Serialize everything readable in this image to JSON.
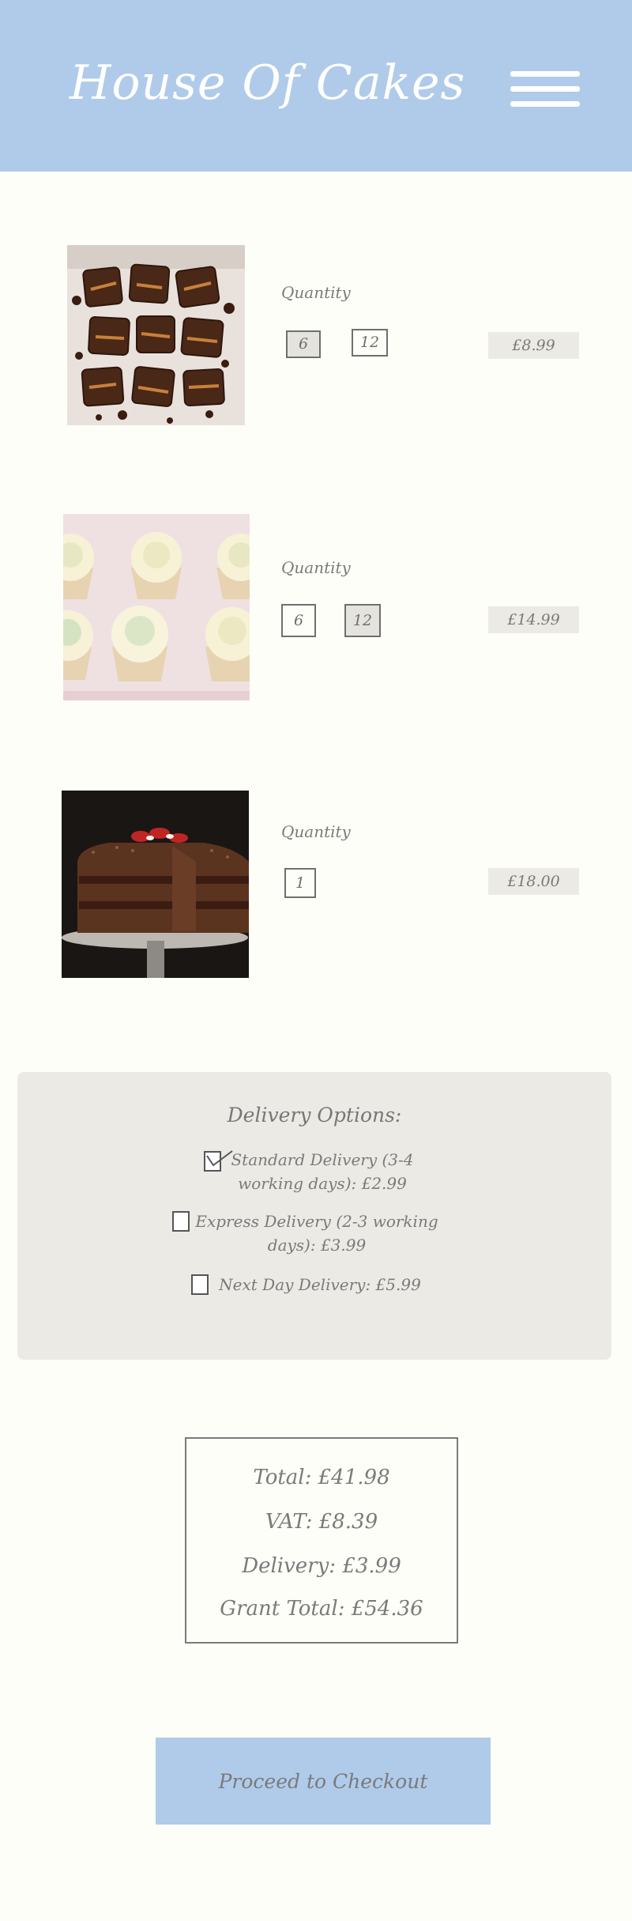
{
  "header": {
    "brand": "House Of Cakes",
    "menu_icon": "hamburger-menu-icon",
    "background": "#b0cbea"
  },
  "products": [
    {
      "name_icon": "chocolate-brownies-image",
      "quantity_label": "Quantity",
      "options": [
        "6",
        "12"
      ],
      "selected": "6",
      "price": "£8.99"
    },
    {
      "name_icon": "cupcakes-image",
      "quantity_label": "Quantity",
      "options": [
        "6",
        "12"
      ],
      "selected": "12",
      "price": "£14.99"
    },
    {
      "name_icon": "chocolate-layer-cake-image",
      "quantity_label": "Quantity",
      "options": [
        "1"
      ],
      "selected": "",
      "price": "£18.00"
    }
  ],
  "delivery": {
    "title": "Delivery Options:",
    "options": [
      {
        "label_line1": "Standard Delivery (3-4",
        "label_line2": "working days): £2.99",
        "checked": true
      },
      {
        "label_line1": "Express Delivery (2-3 working",
        "label_line2": "days): £3.99",
        "checked": false
      },
      {
        "label_line1": "Next Day Delivery: £5.99",
        "label_line2": "",
        "checked": false
      }
    ]
  },
  "totals": {
    "total": "Total: £41.98",
    "vat": "VAT: £8.39",
    "delivery": "Delivery: £3.99",
    "grand_total": "Grant Total: £54.36"
  },
  "checkout": {
    "label": "Proceed to Checkout"
  },
  "colors": {
    "accent": "#b0cbea",
    "panel": "#ebeae5",
    "page": "#fefef9",
    "text": "#7a7a7a"
  }
}
